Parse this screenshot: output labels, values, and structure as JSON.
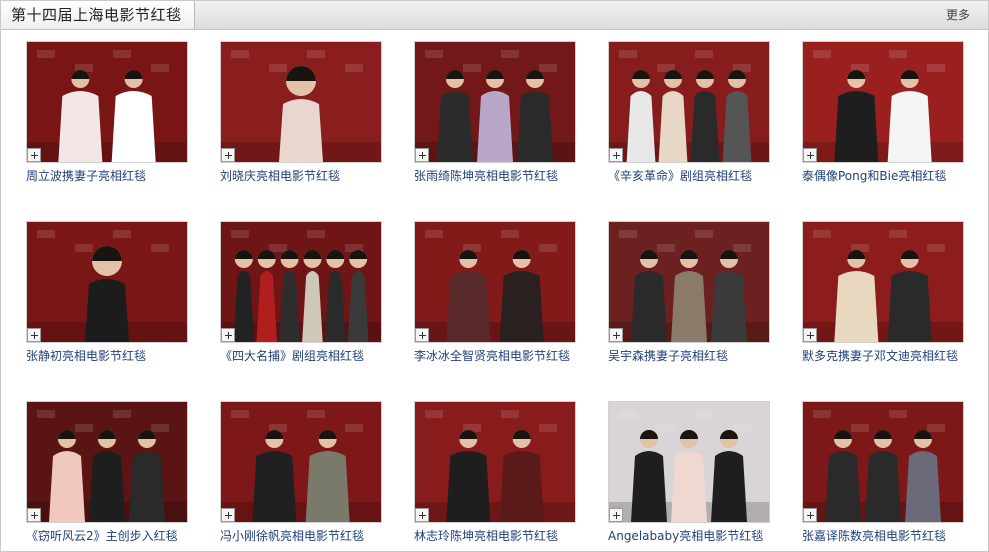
{
  "header": {
    "title": "第十四届上海电影节红毯",
    "more_label": "更多"
  },
  "colors": {
    "caption_link": "#1f3f78",
    "carpet_red": "#8b1a1a",
    "header_bg": "#dcdcdc"
  },
  "gallery": {
    "items": [
      {
        "caption": "周立波携妻子亮相红毯",
        "bg": "#7a1515",
        "figures": [
          "#f2e6e6",
          "#ffffff"
        ],
        "icon": "expand-icon"
      },
      {
        "caption": "刘晓庆亮相电影节红毯",
        "bg": "#8a1d1d",
        "figures": [
          "#e9d6cf"
        ],
        "icon": "expand-icon"
      },
      {
        "caption": "张雨绮陈坤亮相电影节红毯",
        "bg": "#731818",
        "figures": [
          "#2b2b2b",
          "#b9a7c9",
          "#2a2a2a"
        ],
        "icon": "expand-icon"
      },
      {
        "caption": "《辛亥革命》剧组亮相红毯",
        "bg": "#861c1c",
        "figures": [
          "#e8e8e8",
          "#e8d6c6",
          "#2a2a2a",
          "#555555"
        ],
        "icon": "expand-icon"
      },
      {
        "caption": "泰偶像Pong和Bie亮相红毯",
        "bg": "#9a2020",
        "figures": [
          "#1e1e1e",
          "#f5f5f5"
        ],
        "icon": "expand-icon"
      },
      {
        "caption": "张静初亮相电影节红毯",
        "bg": "#7b1616",
        "figures": [
          "#1c1c1c"
        ],
        "icon": "expand-icon"
      },
      {
        "caption": "《四大名捕》剧组亮相红毯",
        "bg": "#6f1515",
        "figures": [
          "#222222",
          "#b11e1e",
          "#2d2d2d",
          "#cfc7b8",
          "#2a2a2a",
          "#3a3a3a"
        ],
        "icon": "expand-icon"
      },
      {
        "caption": "李冰冰全智贤亮相电影节红毯",
        "bg": "#821a1a",
        "figures": [
          "#5a2a2a",
          "#2a2020"
        ],
        "icon": "expand-icon"
      },
      {
        "caption": "吴宇森携妻子亮相红毯",
        "bg": "#6d2020",
        "figures": [
          "#2a2a2a",
          "#8a7a6a",
          "#3a3a3a"
        ],
        "icon": "expand-icon"
      },
      {
        "caption": "默多克携妻子邓文迪亮相红毯",
        "bg": "#8d1c1c",
        "figures": [
          "#e8d8c0",
          "#2a2a2a"
        ],
        "icon": "expand-icon"
      },
      {
        "caption": "《窃听风云2》主创步入红毯",
        "bg": "#5a1414",
        "figures": [
          "#f0c8c0",
          "#1e1e1e",
          "#2a2a2a"
        ],
        "icon": "expand-icon"
      },
      {
        "caption": "冯小刚徐帆亮相电影节红毯",
        "bg": "#7e1818",
        "figures": [
          "#202020",
          "#7a7a6a"
        ],
        "icon": "expand-icon"
      },
      {
        "caption": "林志玲陈坤亮相电影节红毯",
        "bg": "#881b1b",
        "figures": [
          "#1e1e1e",
          "#5a1a1a"
        ],
        "icon": "expand-icon"
      },
      {
        "caption": "Angelababy亮相电影节红毯",
        "bg": "#d8d4d8",
        "figures": [
          "#1e1e1e",
          "#f0d8d0",
          "#1e1e1e"
        ],
        "icon": "expand-icon"
      },
      {
        "caption": "张嘉译陈数亮相电影节红毯",
        "bg": "#7c1818",
        "figures": [
          "#2a2a2a",
          "#2a2a2a",
          "#6a6a7a"
        ],
        "icon": "expand-icon"
      }
    ]
  }
}
